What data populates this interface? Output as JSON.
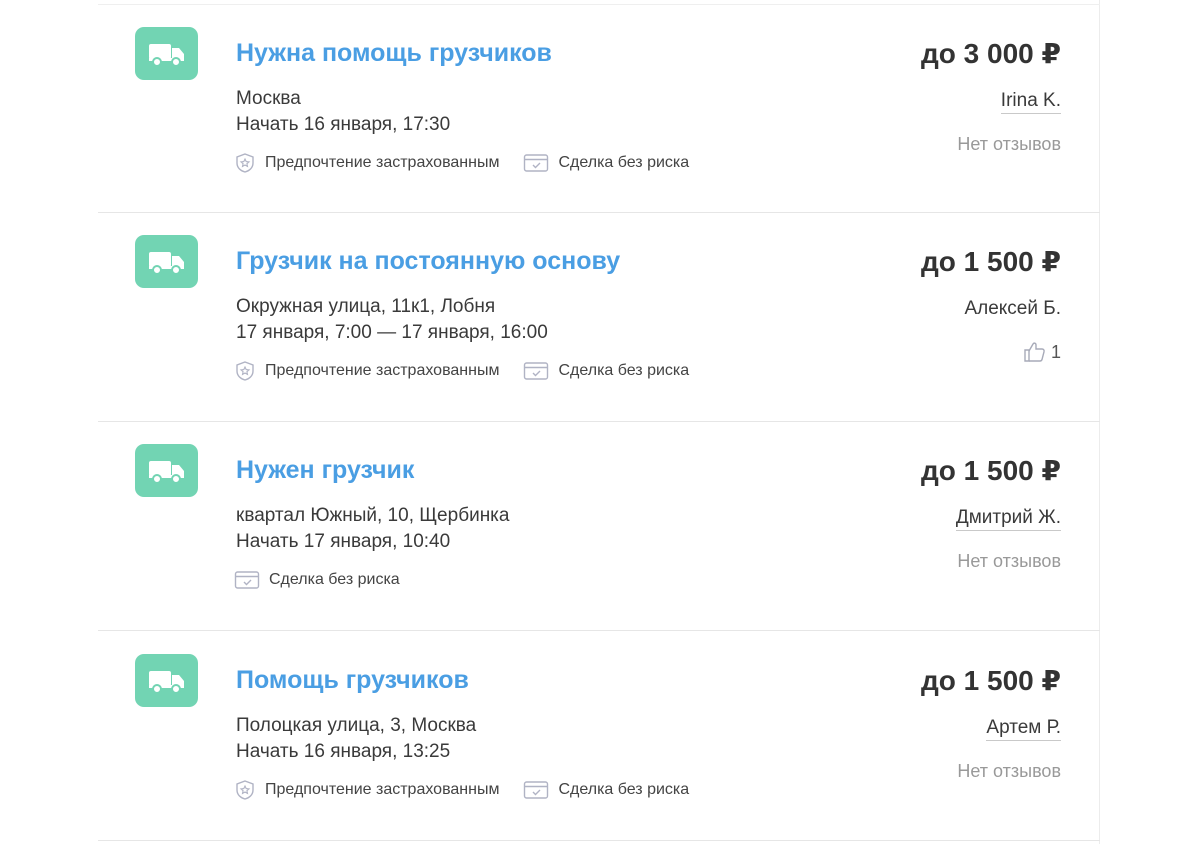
{
  "orders": [
    {
      "title": "Нужна помощь грузчиков",
      "location": "Москва",
      "time": "Начать 16 января, 17:30",
      "badges": [
        "Предпочтение застрахованным",
        "Сделка без риска"
      ],
      "price": "до 3 000 ₽",
      "author": "Irina K.",
      "reviews": "Нет отзывов"
    },
    {
      "title": "Грузчик на постоянную основу",
      "location": "Окружная улица, 11к1, Лобня",
      "time": "17 января, 7:00 — 17 января, 16:00",
      "badges": [
        "Предпочтение застрахованным",
        "Сделка без риска"
      ],
      "price": "до 1 500 ₽",
      "author": "Алексей Б.",
      "likes": "1"
    },
    {
      "title": "Нужен грузчик",
      "location": "квартал Южный, 10, Щербинка",
      "time": "Начать 17 января, 10:40",
      "badges": [
        "Сделка без риска"
      ],
      "price": "до 1 500 ₽",
      "author": "Дмитрий Ж.",
      "reviews": "Нет отзывов"
    },
    {
      "title": "Помощь грузчиков",
      "location": "Полоцкая улица, 3, Москва",
      "time": "Начать 16 января, 13:25",
      "badges": [
        "Предпочтение застрахованным",
        "Сделка без риска"
      ],
      "price": "до 1 500 ₽",
      "author": "Артем Р.",
      "reviews": "Нет отзывов"
    }
  ],
  "icons": {
    "category": "truck-icon",
    "insured": "shield-star-icon",
    "safe_deal": "card-check-icon",
    "likes": "thumbs-up-icon"
  },
  "colors": {
    "accent": "#4a9ee3",
    "icon_bg": "#72d4b3",
    "muted": "#999999"
  }
}
